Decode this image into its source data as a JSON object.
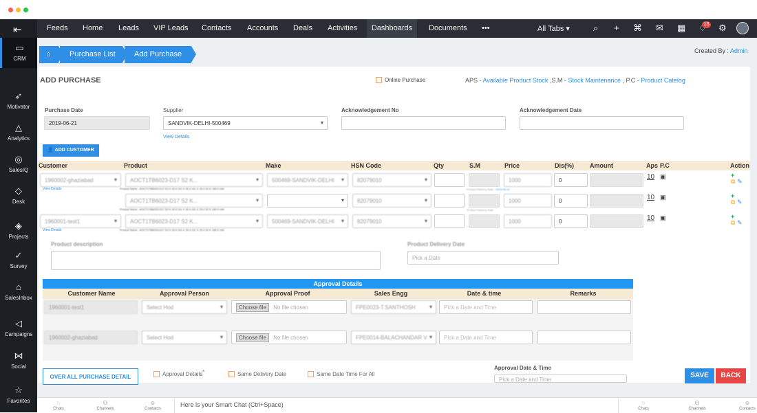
{
  "window": {
    "dots": [
      "#ff5f57",
      "#febc2e",
      "#28c840"
    ]
  },
  "sidebar": [
    {
      "label": "CRM",
      "icon": "crm-icon"
    },
    {
      "label": "Motivator",
      "icon": "rocket-icon"
    },
    {
      "label": "Analytics",
      "icon": "analytics-icon"
    },
    {
      "label": "SalesIQ",
      "icon": "salesiq-icon"
    },
    {
      "label": "Desk",
      "icon": "desk-icon"
    },
    {
      "label": "Projects",
      "icon": "projects-icon"
    },
    {
      "label": "Survey",
      "icon": "survey-icon"
    },
    {
      "label": "SalesInbox",
      "icon": "salesinbox-icon"
    },
    {
      "label": "Campaigns",
      "icon": "campaigns-icon"
    },
    {
      "label": "Social",
      "icon": "social-icon"
    },
    {
      "label": "Favorites",
      "icon": "star-icon"
    }
  ],
  "nav": [
    "Feeds",
    "Home",
    "Leads",
    "VIP Leads",
    "Contacts",
    "Accounts",
    "Deals",
    "Activities",
    "Dashboards",
    "Documents",
    "•••"
  ],
  "all_tabs": "All Tabs ▾",
  "notification_count": "13",
  "breadcrumb": {
    "home": "⌂",
    "purchase_list": "Purchase List",
    "add_purchase": "Add Purchase"
  },
  "created_by": {
    "label": "Created By : ",
    "name": "Admin"
  },
  "page_title": "ADD PURCHASE",
  "online_purchase": "Online Purchase",
  "legend": {
    "aps": "APS - ",
    "aps_link": "Available Product Stock",
    "sm": " ,S.M - ",
    "sm_link": "Stock Maintenance",
    "pc": " , P.C - ",
    "pc_link": "Product Catelog"
  },
  "form": {
    "purchase_date_label": "Purchase Date",
    "purchase_date": "2019-06-21",
    "supplier_label": "Supplier",
    "supplier": "SANDVIK-DELHI-500469",
    "view_details": "View Details",
    "ack_no_label": "Acknowledgement No",
    "ack_date_label": "Acknowledgement Date",
    "add_customer": "ADD CUSTOMER"
  },
  "table_headers": [
    "Customer",
    "Product",
    "Make",
    "HSN Code",
    "Qty",
    "S.M",
    "Price",
    "Dis(%)",
    "Amount",
    "Aps",
    "P.C",
    "Action"
  ],
  "rows": [
    {
      "customer": "1960002-ghaziabad",
      "product": "AOCT1TB6023-D17 S2 K...",
      "product_name": "Product Name : AOCT1TB6023-D17 S2 K 30.0 G/L K 30.0 G/L K 25.0 32 K 180.0 mkt",
      "make": "500469-SANDVIK-DELHI",
      "hsn": "82079010",
      "qty": "",
      "sm": "",
      "price": "1000",
      "delivery": "Product Delivery Date :",
      "delivery_date": "2019-06-21",
      "discount": "0",
      "aps": "10",
      "view": "View Details"
    },
    {
      "customer": "",
      "product": "AOCT1TB6023-D17 S2 K...",
      "product_name": "Product Name : AOCT1TB6023-D17 S2 K 30.0 G/L K 30.0 G/L K 25.0 32 K 180.0 mkt",
      "make": "",
      "hsn": "82079010",
      "qty": "",
      "sm": "",
      "price": "1000",
      "delivery": "Product Delivery Date :",
      "delivery_date": "",
      "discount": "0",
      "aps": "10",
      "view": ""
    },
    {
      "customer": "1960001-test1",
      "product": "AOCT1TB6023-D17 S2 K...",
      "product_name": "Product Name : AOCT1TB6023-D17 S2 K 30.0 G/L K 30.0 G/L K 25.0 32 K 180.0 mkt",
      "make": "500469-SANDVIK-DELHI",
      "hsn": "82079010",
      "qty": "",
      "sm": "",
      "price": "1000",
      "delivery": "",
      "delivery_date": "",
      "discount": "0",
      "aps": "10",
      "view": "View Details"
    }
  ],
  "product_description_label": "Product description",
  "product_delivery_date_label": "Product Delivery Date",
  "pick_date": "Pick a Date",
  "approval": {
    "title": "Approval Details",
    "headers": [
      "Customer Name",
      "Approval Person",
      "Approval Proof",
      "Sales Engg",
      "Date & time",
      "Remarks"
    ],
    "rows": [
      {
        "customer": "1960001-test1",
        "person": "Select Hod",
        "choose": "Choose file",
        "file": "No file chosen",
        "sales": "FPE0023-T.SANTHOSH",
        "date": "Pick a Date and Time"
      },
      {
        "customer": "1960002-ghaziabad",
        "person": "Select Hod",
        "choose": "Choose file",
        "file": "No file chosen",
        "sales": "FPE0014-BALACHANDAR V",
        "date": "Pick a Date and Time"
      }
    ]
  },
  "bottom": {
    "overall": "OVER ALL PURCHASE DETAIL",
    "approval_details": "Approval Details",
    "required": "*",
    "same_delivery": "Same Delivery Date",
    "same_datetime": "Same Date Time For All",
    "approval_dt_label": "Approval Date & Time",
    "approval_dt_placeholder": "Pick a Date and Time",
    "save": "SAVE",
    "back": "BACK"
  },
  "footer": {
    "chats": "Chats",
    "channels": "Channels",
    "contacts": "Contacts",
    "smart_chat": "Here is your Smart Chat (Ctrl+Space)"
  }
}
